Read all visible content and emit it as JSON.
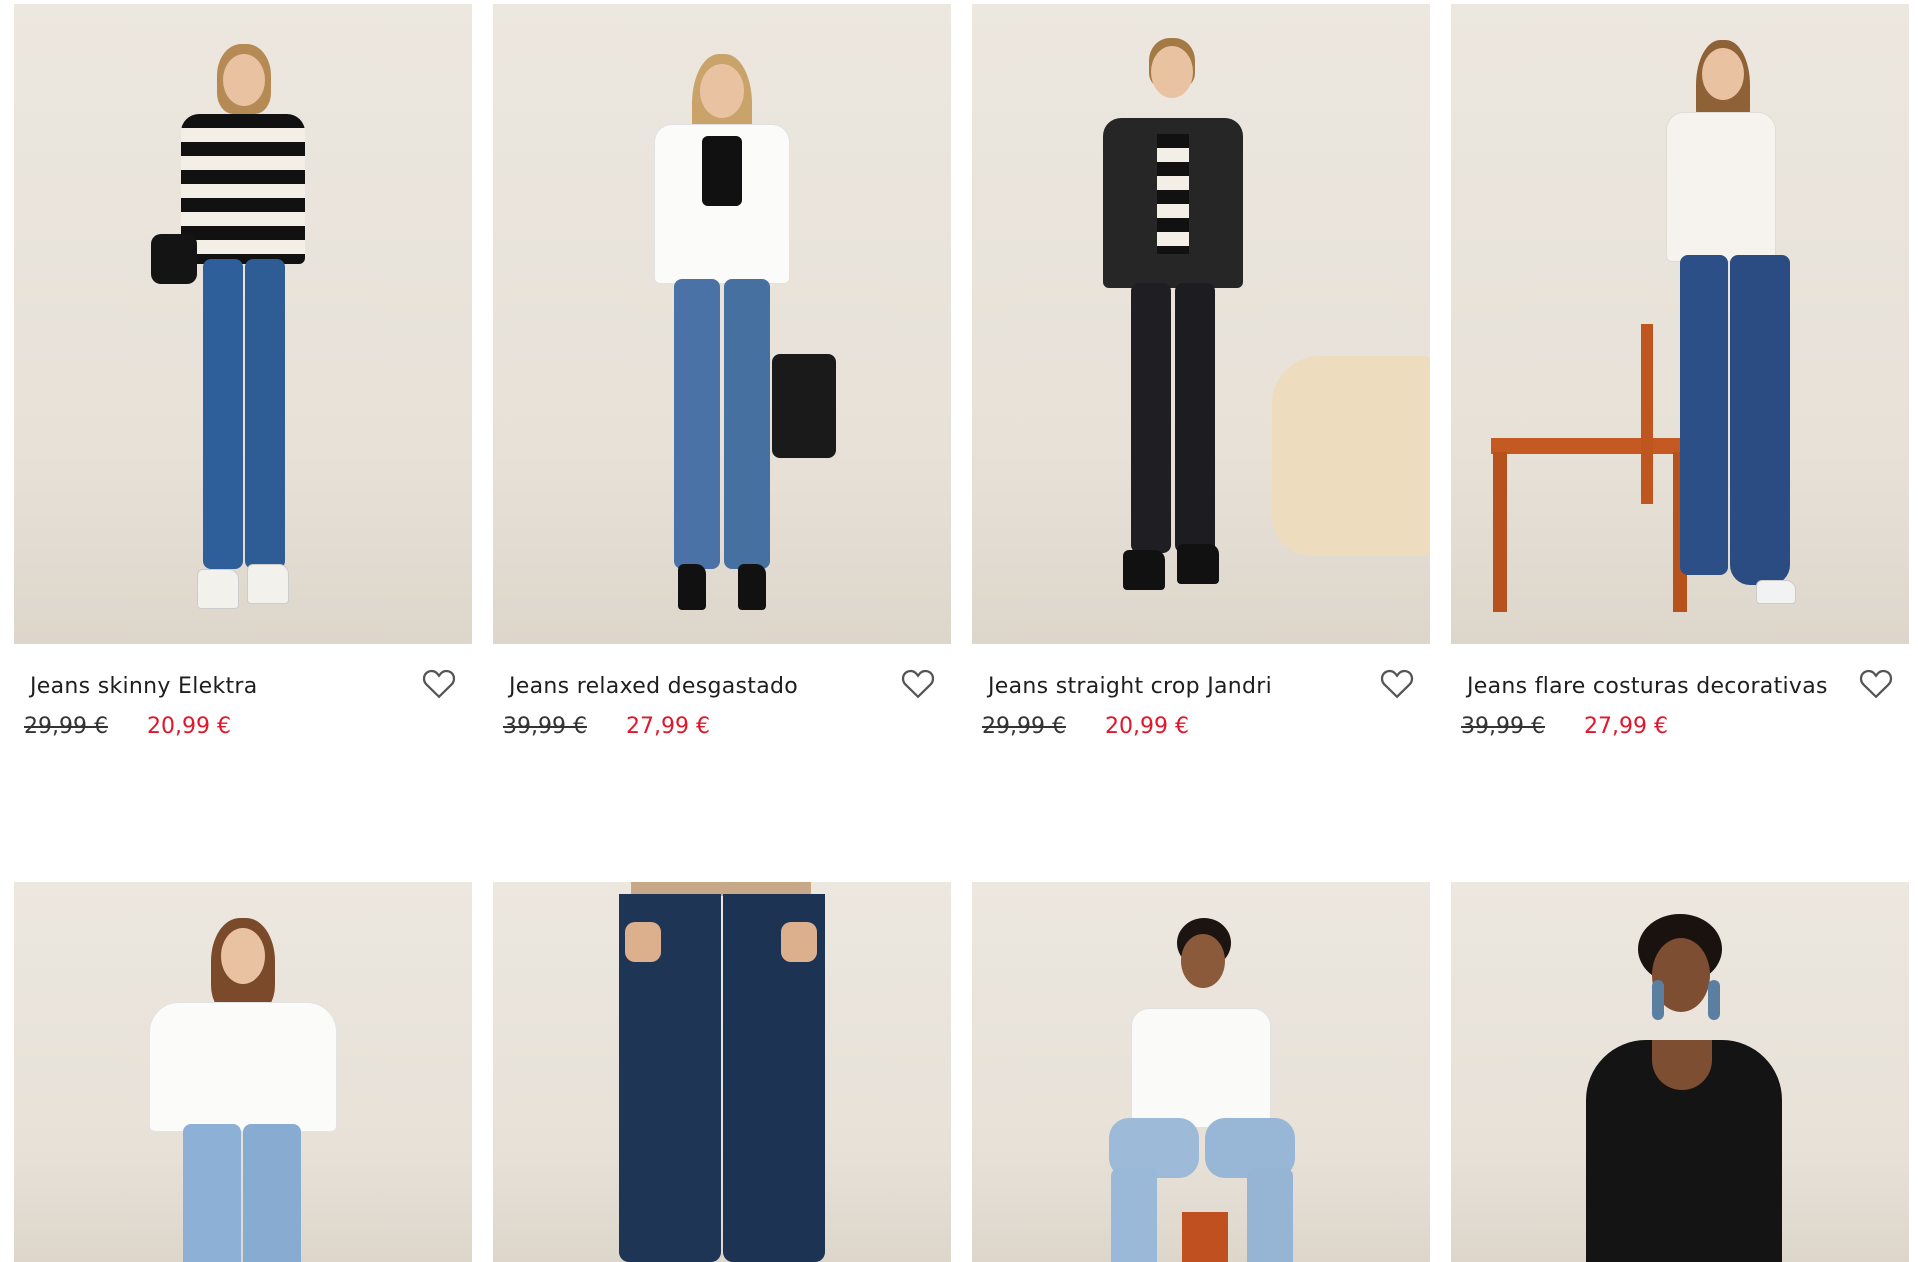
{
  "products": [
    {
      "name": "Jeans skinny Elektra",
      "old_price": "29,99 €",
      "new_price": "20,99 €"
    },
    {
      "name": "Jeans relaxed desgastado",
      "old_price": "39,99 €",
      "new_price": "27,99 €"
    },
    {
      "name": "Jeans straight crop Jandri",
      "old_price": "29,99 €",
      "new_price": "20,99 €"
    },
    {
      "name": "Jeans flare costuras decorativas",
      "old_price": "39,99 €",
      "new_price": "27,99 €"
    }
  ],
  "colors": {
    "sale_price": "#e0162b",
    "photo_background": "#ece7df",
    "wishlist_icon": "#555555"
  },
  "icons": {
    "wishlist": "heart-icon"
  }
}
